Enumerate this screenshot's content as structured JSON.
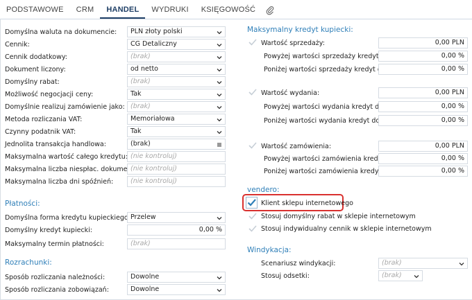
{
  "tabs": [
    {
      "label": "PODSTAWOWE"
    },
    {
      "label": "CRM"
    },
    {
      "label": "HANDEL"
    },
    {
      "label": "WYDRUKI"
    },
    {
      "label": "KSIĘGOWOŚĆ"
    }
  ],
  "left": {
    "fields": [
      {
        "label": "Domyślna waluta na dokumencie:",
        "value": "PLN złoty polski"
      },
      {
        "label": "Cennik:",
        "value": "CG    Detaliczny"
      },
      {
        "label": "Cennik dodatkowy:",
        "value": "(brak)"
      },
      {
        "label": "Dokument liczony:",
        "value": "od netto"
      },
      {
        "label": "Domyślny rabat:",
        "value": "(brak)"
      },
      {
        "label": "Możliwość negocjacji ceny:",
        "value": "Tak"
      },
      {
        "label": "Domyślnie realizuj zamówienie jako:",
        "value": "(brak)"
      },
      {
        "label": "Metoda rozliczania VAT:",
        "value": "Memoriałowa"
      },
      {
        "label": "Czynny podatnik VAT:",
        "value": "Tak"
      },
      {
        "label": "Jednolita transakcja handlowa:",
        "value": "(brak)"
      },
      {
        "label": "Maksymalna wartość całego kredytu:",
        "value": "(nie kontroluj)"
      },
      {
        "label": "Maksymalna liczba niespłac. dokumentów:",
        "value": "(nie kontroluj)"
      },
      {
        "label": "Maksymalna liczba dni spóźnień:",
        "value": "(nie kontroluj)"
      }
    ],
    "platnosci": {
      "title": "Płatności:",
      "fields": [
        {
          "label": "Domyślna forma kredytu kupieckiego:",
          "value": "Przelew"
        },
        {
          "label": "Domyślny kredyt kupiecki:",
          "value": "0,00 %"
        },
        {
          "label": "Maksymalny termin płatności:",
          "value": "(brak)"
        }
      ]
    },
    "rozrachunki": {
      "title": "Rozrachunki:",
      "fields": [
        {
          "label": "Sposób rozliczania należności:",
          "value": "Dowolne"
        },
        {
          "label": "Sposób rozliczania zobowiązań:",
          "value": "Dowolne"
        }
      ]
    }
  },
  "right": {
    "credit_title": "Maksymalny kredyt kupiecki:",
    "groups": [
      {
        "main_label": "Wartość sprzedaży:",
        "main_value": "0,00 PLN",
        "sub": [
          {
            "label": "Powyżej wartości sprzedaży kredyt do:",
            "value": "0,00 %"
          },
          {
            "label": "Poniżej wartości sprzedaży kredyt do:",
            "value": "0,00 %"
          }
        ]
      },
      {
        "main_label": "Wartość wydania:",
        "main_value": "0,00 PLN",
        "sub": [
          {
            "label": "Powyżej wartości wydania kredyt do:",
            "value": "0,00 %"
          },
          {
            "label": "Poniżej wartości wydania kredyt do:",
            "value": "0,00 %"
          }
        ]
      },
      {
        "main_label": "Wartość zamówienia:",
        "main_value": "0,00 PLN",
        "sub": [
          {
            "label": "Powyżej wartości zamówienia kredyt do:",
            "value": "0,00 %"
          },
          {
            "label": "Poniżej wartości zamówienia kredyt do:",
            "value": "0,00 %"
          }
        ]
      }
    ],
    "vendero": {
      "title": "vendero:",
      "options": [
        {
          "label": "Klient sklepu internetowego",
          "checked": true
        },
        {
          "label": "Stosuj domyślny rabat w sklepie internetowym",
          "checked": false
        },
        {
          "label": "Stosuj indywidualny cennik w sklepie internetowym",
          "checked": false
        }
      ]
    },
    "windykacja": {
      "title": "Windykacja:",
      "fields": [
        {
          "label": "Scenariusz windykacji:",
          "value": "(brak)"
        },
        {
          "label": "Stosuj odsetki:",
          "value": "(brak)"
        }
      ]
    }
  },
  "colors": {
    "accent": "#2f7fb8",
    "highlight": "#d9302e",
    "check": "#2f7fb8"
  },
  "icons": {
    "attachment": "paperclip-icon",
    "dropdown": "chevron-down-icon",
    "menu": "menu-lines-icon"
  }
}
